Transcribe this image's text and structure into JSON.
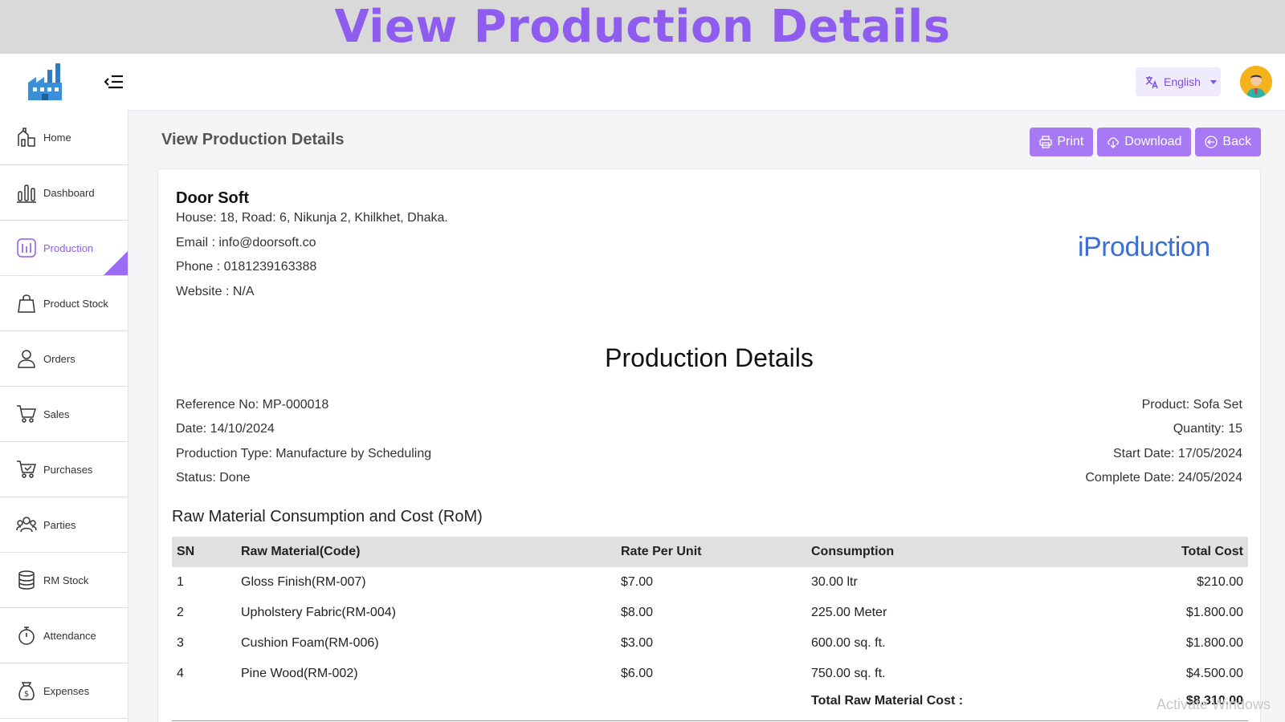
{
  "banner": {
    "title": "View Production Details"
  },
  "header": {
    "language": "English",
    "icons": {
      "logo": "factory-logo",
      "menu": "menu-collapse-icon",
      "language": "translate-icon",
      "avatar": "user-avatar"
    }
  },
  "sidebar": {
    "items": [
      {
        "label": "Home",
        "icon": "home-icon"
      },
      {
        "label": "Dashboard",
        "icon": "chart-bars-icon"
      },
      {
        "label": "Production",
        "icon": "production-icon",
        "active": true
      },
      {
        "label": "Product Stock",
        "icon": "bag-icon"
      },
      {
        "label": "Orders",
        "icon": "user-icon"
      },
      {
        "label": "Sales",
        "icon": "cart-icon"
      },
      {
        "label": "Purchases",
        "icon": "cart-check-icon"
      },
      {
        "label": "Parties",
        "icon": "users-icon"
      },
      {
        "label": "RM Stock",
        "icon": "database-icon"
      },
      {
        "label": "Attendance",
        "icon": "stopwatch-icon"
      },
      {
        "label": "Expenses",
        "icon": "money-bag-icon"
      }
    ]
  },
  "page": {
    "title": "View Production Details",
    "actions": {
      "print": "Print",
      "download": "Download",
      "back": "Back"
    }
  },
  "company": {
    "name": "Door Soft",
    "address": "House: 18, Road: 6, Nikunja 2, Khilkhet, Dhaka.",
    "email": "Email : info@doorsoft.co",
    "phone": "Phone : 0181239163388",
    "website": "Website : N/A",
    "brand": "iProduction"
  },
  "doc": {
    "title": "Production Details",
    "reference": "Reference No: MP-000018",
    "date": "Date: 14/10/2024",
    "type": "Production Type: Manufacture by Scheduling",
    "status": "Status: Done",
    "product": "Product: Sofa Set",
    "quantity": "Quantity: 15",
    "start": "Start Date: 17/05/2024",
    "complete": "Complete Date: 24/05/2024"
  },
  "rom": {
    "title": "Raw Material Consumption and Cost (RoM)",
    "headers": {
      "sn": "SN",
      "material": "Raw Material(Code)",
      "rate": "Rate Per Unit",
      "consumption": "Consumption",
      "total": "Total Cost"
    },
    "rows": [
      {
        "sn": "1",
        "material": "Gloss Finish(RM-007)",
        "rate": "$7.00",
        "consumption": "30.00 ltr",
        "total": "$210.00"
      },
      {
        "sn": "2",
        "material": "Upholstery Fabric(RM-004)",
        "rate": "$8.00",
        "consumption": "225.00 Meter",
        "total": "$1.800.00"
      },
      {
        "sn": "3",
        "material": "Cushion Foam(RM-006)",
        "rate": "$3.00",
        "consumption": "600.00 sq. ft.",
        "total": "$1.800.00"
      },
      {
        "sn": "4",
        "material": "Pine Wood(RM-002)",
        "rate": "$6.00",
        "consumption": "750.00 sq. ft.",
        "total": "$4.500.00"
      }
    ],
    "total_label": "Total Raw Material Cost :",
    "total_value": "$8.310.00"
  },
  "overlay": {
    "watermark": "Activate Windows"
  },
  "colors": {
    "accent": "#a779f5",
    "banner_text": "#8f5cf0",
    "brand": "#3b6fd4"
  }
}
